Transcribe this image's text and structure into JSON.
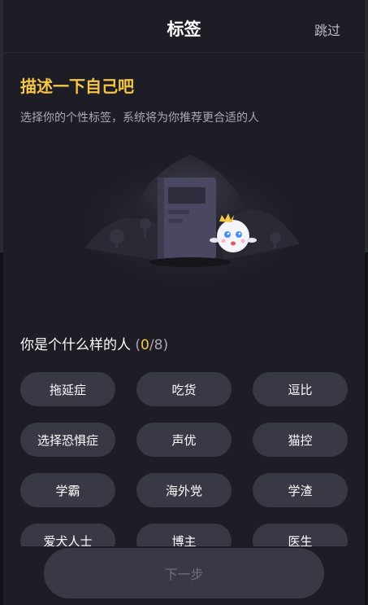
{
  "header": {
    "title": "标签",
    "skip_label": "跳过"
  },
  "intro": {
    "headline": "描述一下自己吧",
    "subtext": "选择你的个性标签，系统将为你推荐更合适的人"
  },
  "question": {
    "text": "你是个什么样的人",
    "selected_count": "0",
    "max_count": "8"
  },
  "tags": [
    {
      "label": "拖延症"
    },
    {
      "label": "吃货"
    },
    {
      "label": "逗比"
    },
    {
      "label": "选择恐惧症"
    },
    {
      "label": "声优"
    },
    {
      "label": "猫控"
    },
    {
      "label": "学霸"
    },
    {
      "label": "海外党"
    },
    {
      "label": "学渣"
    },
    {
      "label": "爱犬人士"
    },
    {
      "label": "博主"
    },
    {
      "label": "医生"
    }
  ],
  "footer": {
    "next_label": "下一步"
  },
  "colors": {
    "accent": "#f6c745",
    "background": "#1e1d25",
    "tag_background": "#393845"
  },
  "icons": {
    "illustration": "book-ghost-illustration"
  }
}
